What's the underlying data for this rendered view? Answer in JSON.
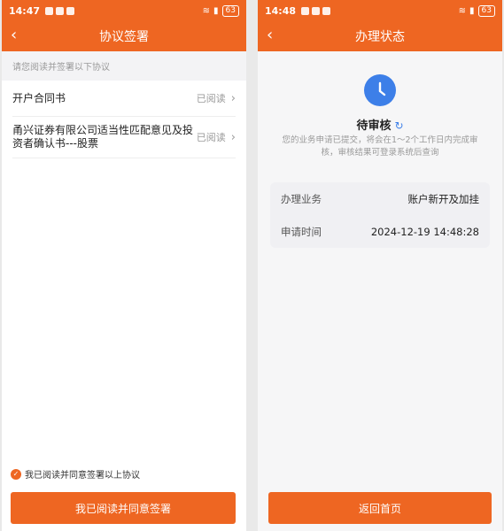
{
  "left": {
    "statusbar": {
      "time": "14:47",
      "battery": "63"
    },
    "title": "协议签署",
    "hint": "请您阅读并签署以下协议",
    "agreements": [
      {
        "name": "开户合同书",
        "status": "已阅读"
      },
      {
        "name": "甬兴证券有限公司适当性匹配意见及投资者确认书---股票",
        "status": "已阅读"
      }
    ],
    "agree_label": "我已阅读并同意签署以上协议",
    "button_label": "我已阅读并同意签署"
  },
  "right": {
    "statusbar": {
      "time": "14:48",
      "battery": "63"
    },
    "title": "办理状态",
    "status_title": "待审核",
    "status_desc": "您的业务申请已提交，将会在1～2个工作日内完成审核，审核结果可登录系统后查询",
    "details": [
      {
        "key": "办理业务",
        "value": "账户新开及加挂"
      },
      {
        "key": "申请时间",
        "value": "2024-12-19 14:48:28"
      }
    ],
    "button_label": "返回首页"
  },
  "colors": {
    "accent": "#ee6622",
    "clock": "#3d7fe8"
  },
  "icons": {
    "back": "chevron-left-icon",
    "refresh": "refresh-icon",
    "clock": "clock-icon",
    "check": "check-circle-icon"
  }
}
